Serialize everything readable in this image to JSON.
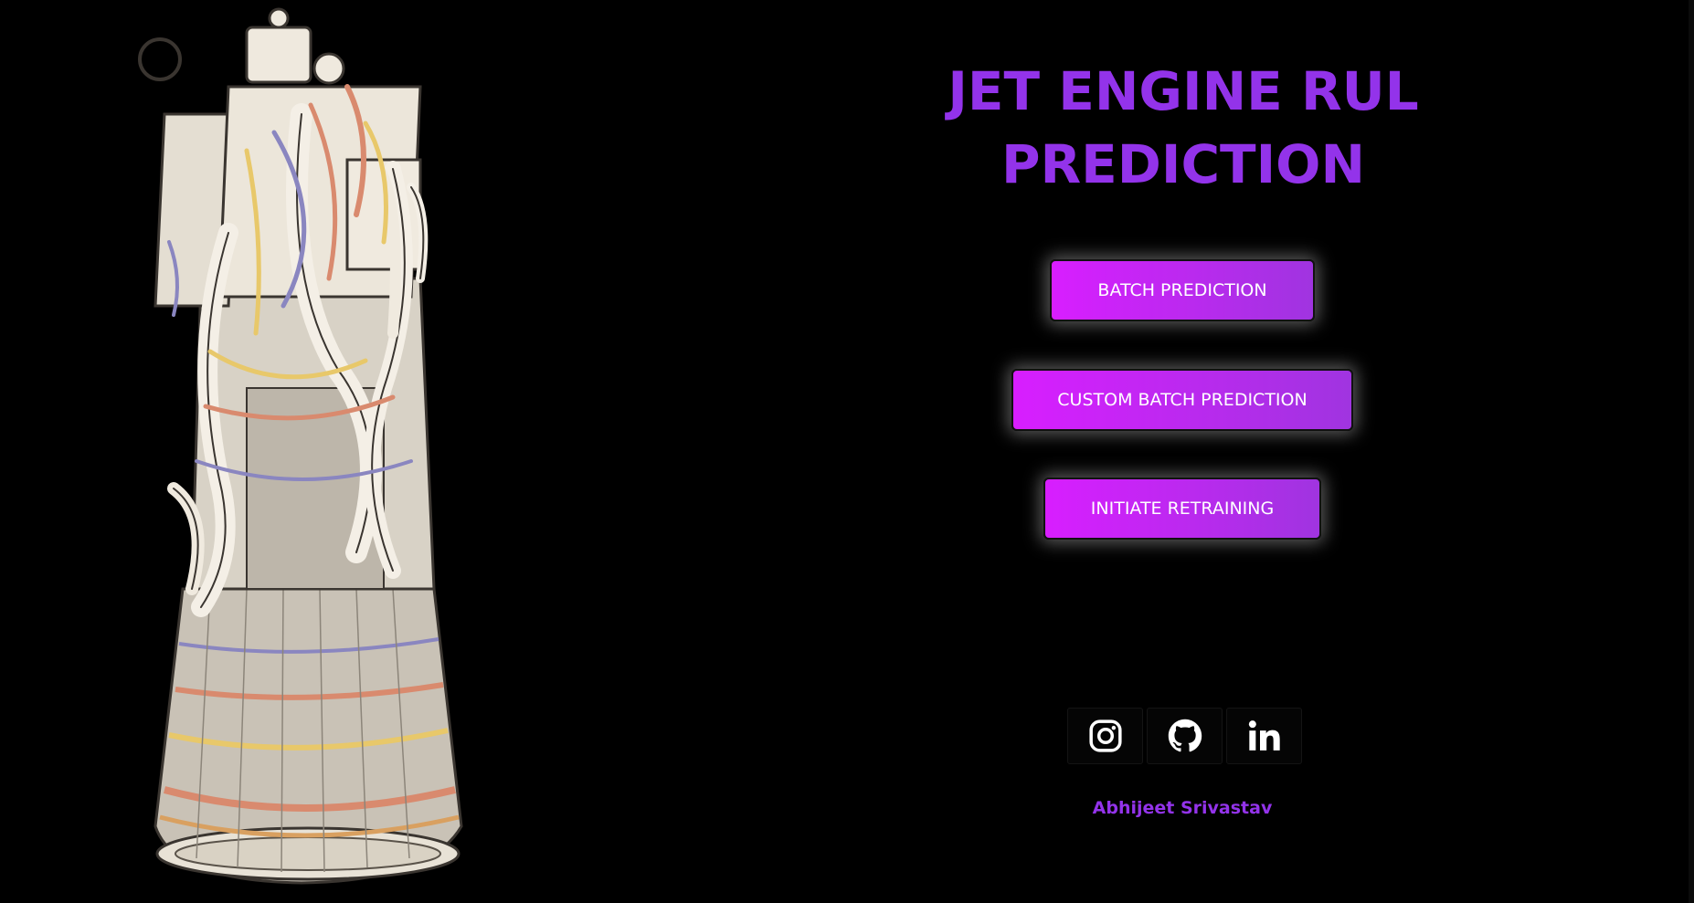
{
  "header": {
    "title": "JET ENGINE RUL PREDICTION"
  },
  "actions": {
    "batch_prediction_label": "BATCH PREDICTION",
    "custom_batch_prediction_label": "CUSTOM BATCH PREDICTION",
    "initiate_retraining_label": "INITIATE RETRAINING"
  },
  "socials": [
    {
      "icon": "instagram-icon"
    },
    {
      "icon": "github-icon"
    },
    {
      "icon": "linkedin-icon"
    }
  ],
  "footer": {
    "author": "Abhijeet Srivastav"
  },
  "colors": {
    "background": "#000000",
    "accent": "#9333ea",
    "button_gradient_start": "#d81eff",
    "button_gradient_end": "#a034e0"
  }
}
